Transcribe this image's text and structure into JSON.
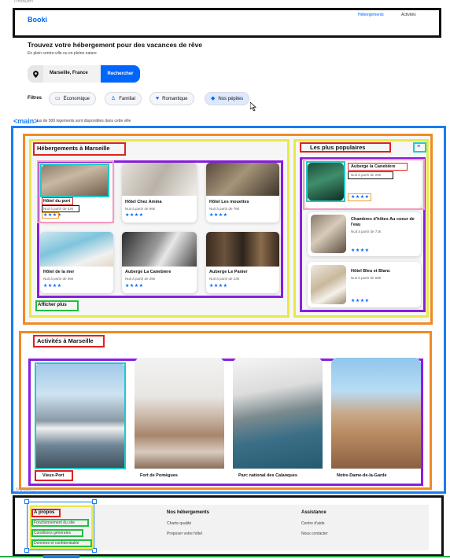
{
  "labels": {
    "header": "header",
    "main": "<main>",
    "footer": "footer>"
  },
  "header": {
    "logo": "Booki",
    "nav": [
      "Hébergements",
      "Activités"
    ]
  },
  "hero": {
    "title": "Trouvez votre hébergement pour des vacances de rêve",
    "subtitle": "En plein centre-ville ou en pleine nature",
    "search_value": "Marseille, France",
    "search_button": "Rechercher"
  },
  "filters": {
    "label": "Filtres",
    "items": [
      {
        "label": "Économique",
        "icon": "money-icon"
      },
      {
        "label": "Familial",
        "icon": "child-icon"
      },
      {
        "label": "Romantique",
        "icon": "heart-icon"
      },
      {
        "label": "Nos pépites",
        "icon": "gem-icon"
      }
    ]
  },
  "info": {
    "text": "lus de 500 logements sont disponibles dans cette ville"
  },
  "hebergements": {
    "title": "Hébergements à Marseille",
    "show_more": "Afficher plus",
    "items": [
      {
        "name": "Hôtel du port",
        "price": "Nuit à partir de 52€",
        "rating": "★★★★"
      },
      {
        "name": "Hôtel Chez Amina",
        "price": "Nuit à partir de 96€",
        "rating": "★★★★"
      },
      {
        "name": "Hôtel Les mouettes",
        "price": "Nuit à partir de 76€",
        "rating": "★★★★"
      },
      {
        "name": "Hôtel de la mer",
        "price": "Nuit à partir de 46€",
        "rating": "★★★★"
      },
      {
        "name": "Auberge La Canebiere",
        "price": "Nuit à partir de 25€",
        "rating": "★★★★"
      },
      {
        "name": "Auberge Le Panier",
        "price": "Nuit à partir de 23€",
        "rating": "★★★★"
      }
    ]
  },
  "populaires": {
    "title": "Les plus populaires",
    "items": [
      {
        "name": "Auberge la Canebière",
        "price": "Nuit à partir de 25€",
        "rating": "★★★★"
      },
      {
        "name": "Chambres d'hôtes Au coeur de l'eau",
        "price": "Nuit à partir de 71€",
        "rating": "★★★★"
      },
      {
        "name": "Hôtel Bleu et Blanc",
        "price": "Nuit à partir de 68€",
        "rating": "★★★★"
      }
    ]
  },
  "activites": {
    "title": "Activités à Marseille",
    "items": [
      "Vieux-Port",
      "Fort de Pomègues",
      "Parc national des Calanques",
      "Notre-Dame-de-la-Garde"
    ]
  },
  "footer": {
    "cols": [
      {
        "title": "À propos",
        "links": [
          "Fonctionnement du site",
          "Conditions générales",
          "Données et confidentialité"
        ]
      },
      {
        "title": "Nos hébergements",
        "links": [
          "Charte qualité",
          "Proposer votre hôtel"
        ]
      },
      {
        "title": "Assistance",
        "links": [
          "Centre d'aide",
          "Nous contacter"
        ]
      }
    ]
  },
  "colors": {
    "brand": "#0065fc",
    "main_frame": "#1a7df0",
    "section_frame": "#f08a24",
    "grid_frame": "#8a1ee0",
    "col_frame": "#e8e84a",
    "title_frame": "#e02020",
    "img_frame": "#22c9c9",
    "link_frame": "#20c040"
  }
}
